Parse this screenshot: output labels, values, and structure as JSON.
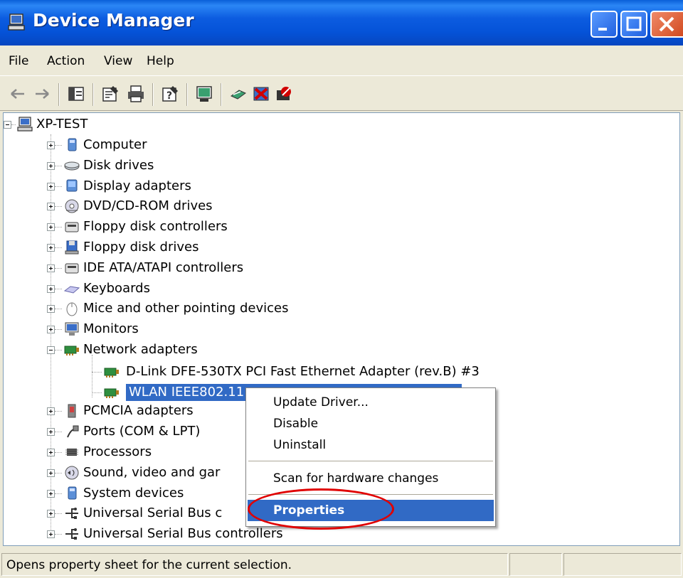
{
  "window": {
    "title": "Device Manager"
  },
  "menu": {
    "file": "File",
    "action": "Action",
    "view": "View",
    "help": "Help"
  },
  "tree": {
    "root": "XP-TEST",
    "items": [
      "Computer",
      "Disk drives",
      "Display adapters",
      "DVD/CD-ROM drives",
      "Floppy disk controllers",
      "Floppy disk drives",
      "IDE ATA/ATAPI controllers",
      "Keyboards",
      "Mice and other pointing devices",
      "Monitors",
      "Network adapters",
      "PCMCIA adapters",
      "Ports (COM & LPT)",
      "Processors",
      "Sound, video and gar",
      "System devices",
      "Universal Serial Bus c",
      "Universal Serial Bus controllers"
    ],
    "network_children": [
      "D-Link DFE-530TX PCI Fast Ethernet Adapter (rev.B) #3",
      "WLAN IEEE802.11"
    ]
  },
  "context_menu": {
    "update_driver": "Update Driver...",
    "disable": "Disable",
    "uninstall": "Uninstall",
    "scan": "Scan for hardware changes",
    "properties": "Properties"
  },
  "status": {
    "text": "Opens property sheet for the current selection."
  },
  "colors": {
    "titlebar": "#0553d8",
    "selection": "#316ac5",
    "highlight_ring": "#e00000"
  }
}
